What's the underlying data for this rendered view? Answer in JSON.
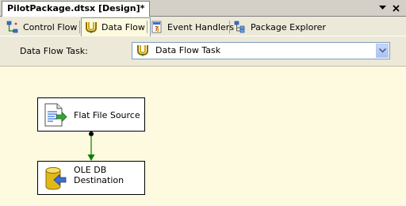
{
  "document": {
    "title": "PilotPackage.dtsx [Design]*"
  },
  "window_controls": {
    "menu_icon": "chevron-down-icon",
    "close_icon": "close-icon"
  },
  "tabs": [
    {
      "label": "Control Flow",
      "icon": "control-flow-icon",
      "active": false
    },
    {
      "label": "Data Flow",
      "icon": "data-flow-icon",
      "active": true
    },
    {
      "label": "Event Handlers",
      "icon": "event-handlers-icon",
      "active": false
    },
    {
      "label": "Package Explorer",
      "icon": "package-explorer-icon",
      "active": false
    }
  ],
  "task_selector": {
    "label": "Data Flow Task:",
    "value": "Data Flow Task",
    "icon": "data-flow-task-icon"
  },
  "components": [
    {
      "label": "Flat File Source",
      "icon": "flat-file-source-icon"
    },
    {
      "label": "OLE DB Destination",
      "icon": "ole-db-destination-icon"
    }
  ],
  "colors": {
    "surface": "#fdfadf",
    "connector": "#008000",
    "accent": "#7f9db9"
  }
}
